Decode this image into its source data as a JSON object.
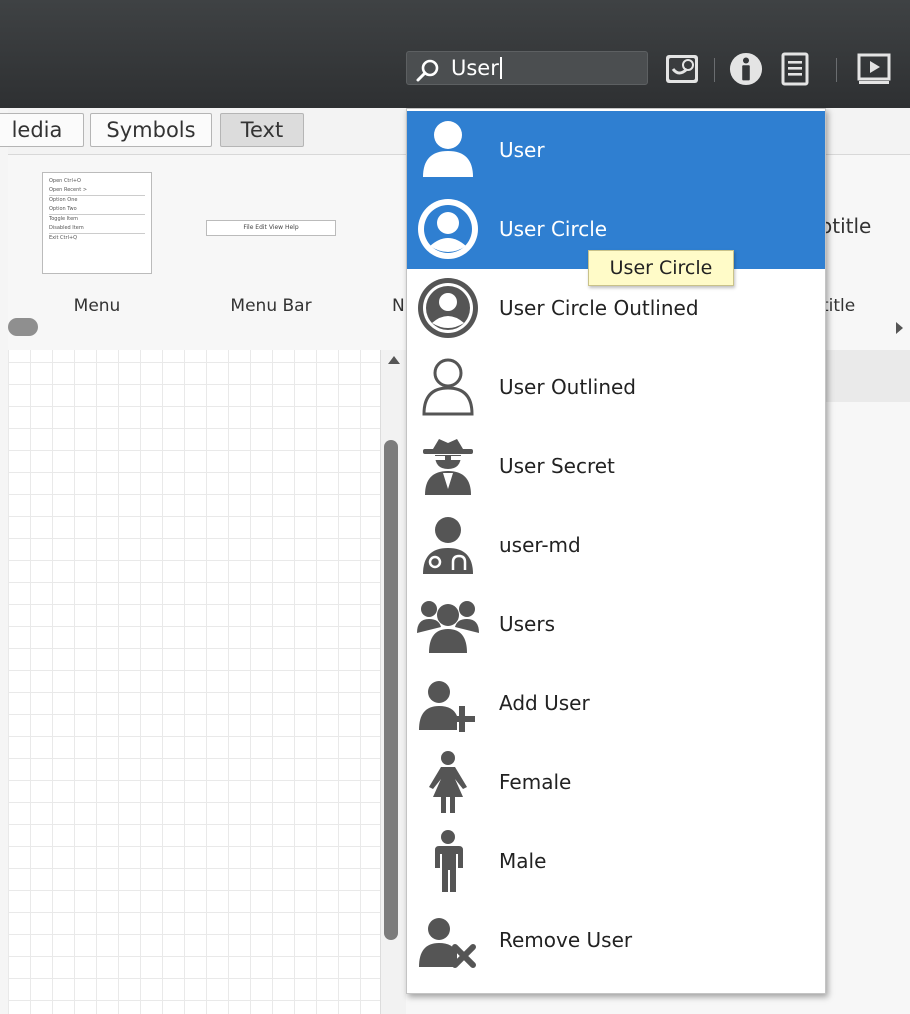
{
  "search": {
    "value": "User"
  },
  "toolbar": {
    "icons": [
      "user-search-icon",
      "info-icon",
      "document-icon",
      "play-icon"
    ]
  },
  "tabs": [
    {
      "label": "Media",
      "display": "ledia"
    },
    {
      "label": "Symbols"
    },
    {
      "label": "Text",
      "active": true
    }
  ],
  "shapes": {
    "menu_label": "Menu",
    "menubar_label": "Menu Bar",
    "peek_label": "N",
    "subtitle_peek": "otitle",
    "subtitle_peek_small": "title",
    "menu_thumb_lines": [
      "Open   Ctrl+O",
      "Open Recent  >",
      "Option One",
      "Option Two",
      "Toggle Item",
      "Disabled Item",
      "Exit   Ctrl+Q"
    ],
    "menubar_thumb": "File  Edit  View  Help"
  },
  "results": [
    {
      "label": "User",
      "icon": "user-icon",
      "selected": true
    },
    {
      "label": "User Circle",
      "icon": "user-circle-icon",
      "selected": true
    },
    {
      "label": "User Circle Outlined",
      "icon": "user-circle-outlined-icon"
    },
    {
      "label": "User Outlined",
      "icon": "user-outlined-icon"
    },
    {
      "label": "User Secret",
      "icon": "user-secret-icon"
    },
    {
      "label": "user-md",
      "icon": "user-md-icon"
    },
    {
      "label": "Users",
      "icon": "users-icon"
    },
    {
      "label": "Add User",
      "icon": "add-user-icon"
    },
    {
      "label": "Female",
      "icon": "female-icon"
    },
    {
      "label": "Male",
      "icon": "male-icon"
    },
    {
      "label": "Remove User",
      "icon": "remove-user-icon"
    }
  ],
  "tooltip": {
    "text": "User Circle"
  },
  "colors": {
    "selection": "#2f7fd1",
    "toolbar": "#353739",
    "icon_gray": "#555555",
    "tooltip_bg": "#fffbc8"
  }
}
